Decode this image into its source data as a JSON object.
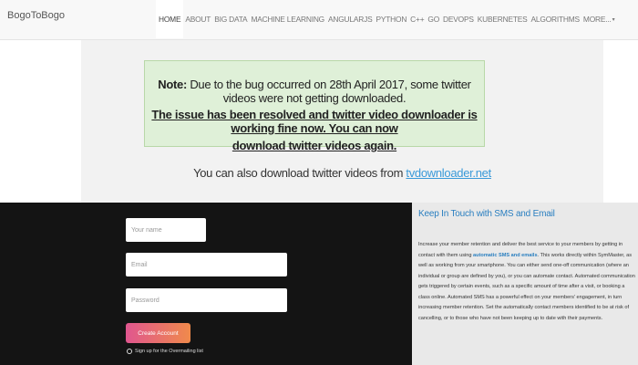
{
  "navbar": {
    "brand": "BogoToBogo",
    "items": [
      {
        "label": "HOME",
        "active": true
      },
      {
        "label": "ABOUT"
      },
      {
        "label": "BIG DATA"
      },
      {
        "label": "MACHINE LEARNING"
      },
      {
        "label": "ANGULARJS"
      },
      {
        "label": "PYTHON"
      },
      {
        "label": "C++"
      },
      {
        "label": "GO"
      },
      {
        "label": "DEVOPS"
      },
      {
        "label": "KUBERNETES"
      },
      {
        "label": "ALGORITHMS"
      },
      {
        "label": "MORE..."
      }
    ]
  },
  "note": {
    "prefix": "Note:",
    "line1": "Due to the bug occurred on 28th April 2017, some twitter videos were not getting downloaded.",
    "line2": "The issue has been resolved and twitter video downloader is working fine now. You can now",
    "line3": "download twitter videos again."
  },
  "also": {
    "text": "You can also download twitter videos from",
    "link": "tvdownloader.net"
  },
  "signup_form": {
    "name_placeholder": "Your name",
    "email_placeholder": "Email",
    "password_placeholder": "Password",
    "submit_label": "Create Account",
    "mailing_list_label": "Sign up for the Overmailing list"
  },
  "info": {
    "title": "Keep In Touch with SMS and Email",
    "body_before": "Increase your member retention and deliver the best service to your members by getting in contact with them using",
    "body_link": "automatic SMS and emails",
    "body_after": ". This works directly within SymMaster, as well as working from your smartphone. You can either send one-off communication (where an individual or group are defined by you), or you can automate contact. Automated communication gets triggered by certain events, such as a specific amount of time after a visit, or booking a class online. Automated SMS has a powerful effect on your members' engagement, in turn increasing member retention. Set the automatically contact members identified to be at risk of cancelling, or to those who have not been keeping up to date with their payments."
  }
}
